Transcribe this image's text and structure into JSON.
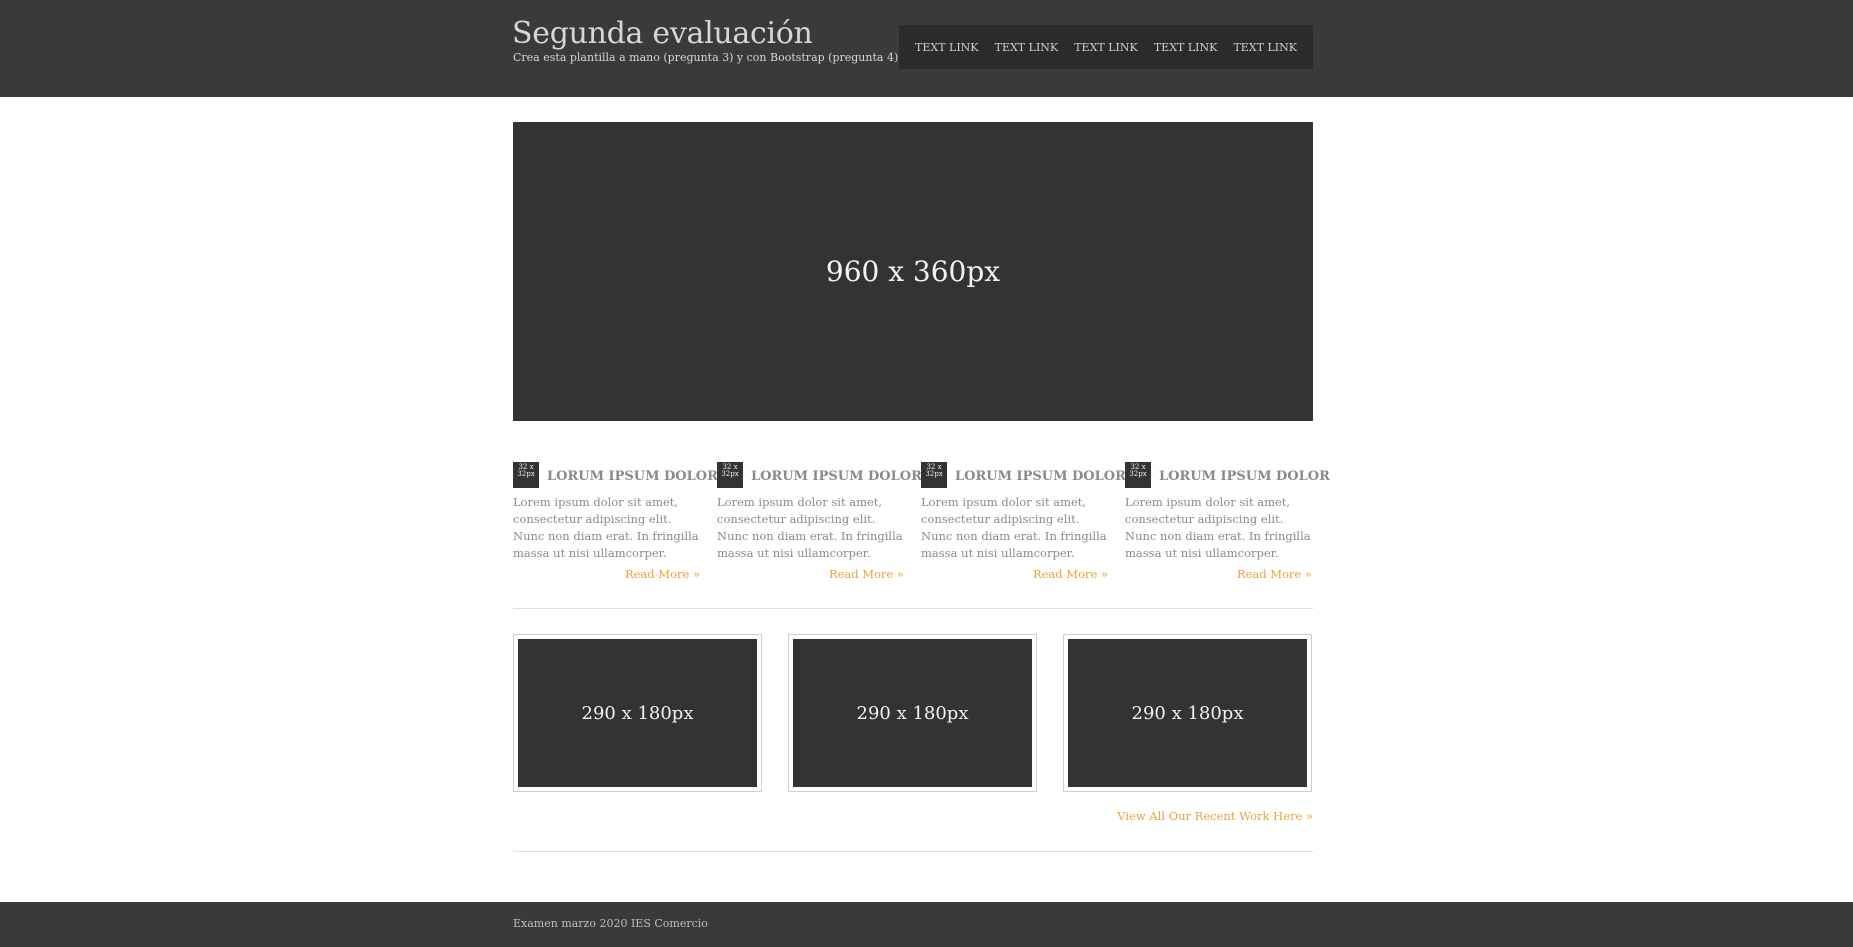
{
  "header": {
    "title": "Segunda evaluación",
    "subtitle": "Crea esta plantilla a mano (pregunta 3) y con Bootstrap (pregunta 4)",
    "nav": [
      "TEXT LINK",
      "TEXT LINK",
      "TEXT LINK",
      "TEXT LINK",
      "TEXT LINK"
    ]
  },
  "hero": {
    "label": "960 x 360px"
  },
  "features": [
    {
      "icon_label": "32 x 32px",
      "title": "LORUM IPSUM DOLOR",
      "text": "Lorem ipsum dolor sit amet, consectetur adipiscing elit. Nunc non diam erat. In fringilla massa ut nisi ullamcorper.",
      "more": "Read More »"
    },
    {
      "icon_label": "32 x 32px",
      "title": "LORUM IPSUM DOLOR",
      "text": "Lorem ipsum dolor sit amet, consectetur adipiscing elit. Nunc non diam erat. In fringilla massa ut nisi ullamcorper.",
      "more": "Read More »"
    },
    {
      "icon_label": "32 x 32px",
      "title": "LORUM IPSUM DOLOR",
      "text": "Lorem ipsum dolor sit amet, consectetur adipiscing elit. Nunc non diam erat. In fringilla massa ut nisi ullamcorper.",
      "more": "Read More »"
    },
    {
      "icon_label": "32 x 32px",
      "title": "LORUM IPSUM DOLOR",
      "text": "Lorem ipsum dolor sit amet, consectetur adipiscing elit. Nunc non diam erat. In fringilla massa ut nisi ullamcorper.",
      "more": "Read More »"
    }
  ],
  "work": {
    "thumbs": [
      "290 x 180px",
      "290 x 180px",
      "290 x 180px"
    ],
    "view_all": "View All Our Recent Work Here »"
  },
  "footer": {
    "text": "Examen marzo 2020 IES Comercio"
  },
  "colors": {
    "dark": "#333333",
    "header_bg": "#3a3a3a",
    "accent": "#e8a33c",
    "body_text": "#8a8a8a"
  }
}
